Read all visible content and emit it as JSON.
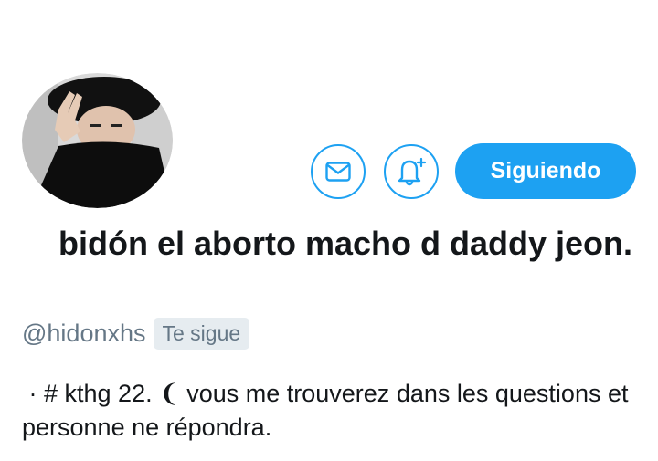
{
  "profile": {
    "display_name": "bidón el aborto macho d daddy jeon.",
    "handle": "@hidonxhs",
    "follows_you_badge": "Te sigue",
    "bio": " · # kthg 22. ❨ vous me trouverez dans les questions et personne ne répondra."
  },
  "actions": {
    "message_icon": "envelope-icon",
    "notify_icon": "bell-plus-icon",
    "follow_label": "Siguiendo"
  },
  "colors": {
    "accent": "#1da1f2",
    "text_primary": "#14171a",
    "text_secondary": "#657786",
    "badge_bg": "#e6ecf0"
  }
}
